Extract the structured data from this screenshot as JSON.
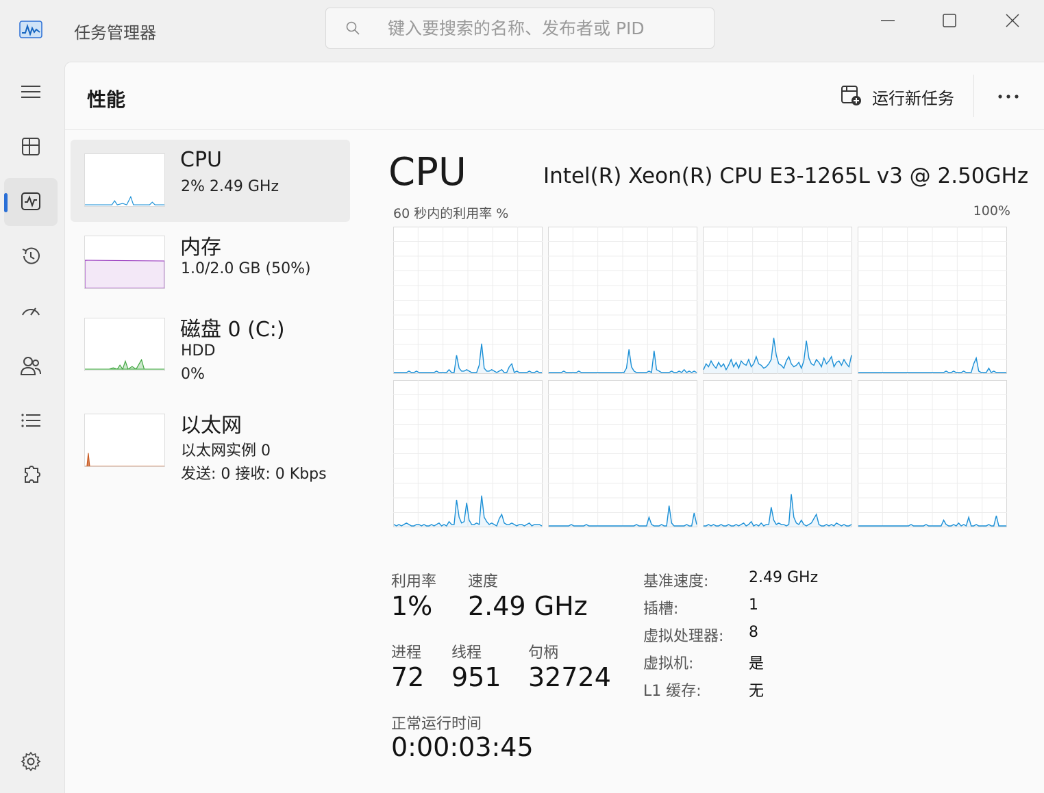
{
  "window": {
    "title": "任务管理器",
    "search_placeholder": "键入要搜索的名称、发布者或 PID"
  },
  "nav": {
    "items": [
      {
        "name": "menu"
      },
      {
        "name": "processes"
      },
      {
        "name": "performance",
        "active": true
      },
      {
        "name": "app-history"
      },
      {
        "name": "startup-apps"
      },
      {
        "name": "users"
      },
      {
        "name": "details"
      },
      {
        "name": "services"
      },
      {
        "name": "settings"
      }
    ]
  },
  "header": {
    "title": "性能",
    "run_new_task": "运行新任务"
  },
  "resources": [
    {
      "title": "CPU",
      "sub1": "2%  2.49 GHz",
      "sub2": "",
      "sub3": "",
      "selected": true,
      "color": "#1a8fd6"
    },
    {
      "title": "内存",
      "sub1": "1.0/2.0 GB (50%)",
      "sub2": "",
      "sub3": "",
      "color": "#9b3fc0"
    },
    {
      "title": "磁盘 0 (C:)",
      "sub1": "HDD",
      "sub2": "0%",
      "sub3": "",
      "color": "#3fa63f"
    },
    {
      "title": "以太网",
      "sub1": "以太网实例 0",
      "sub2": "发送: 0  接收: 0 Kbps",
      "sub3": "",
      "color": "#c8581e"
    }
  ],
  "cpu": {
    "title": "CPU",
    "model": "Intel(R) Xeon(R) CPU E3-1265L v3 @ 2.50GHz",
    "graph_label": "60 秒内的利用率 %",
    "graph_max": "100%",
    "line_color": "#1a8fd6",
    "core_series": [
      [
        0,
        0,
        0,
        0,
        0,
        0,
        1,
        0,
        0,
        1,
        0,
        0,
        0,
        0,
        0,
        0,
        0,
        1,
        0,
        0,
        0,
        0,
        2,
        0,
        0,
        12,
        3,
        1,
        1,
        2,
        1,
        0,
        0,
        0,
        5,
        20,
        3,
        1,
        1,
        2,
        1,
        0,
        1,
        2,
        0,
        0,
        4,
        6,
        0,
        1,
        0,
        0,
        0,
        0,
        1,
        0,
        0,
        1,
        0,
        0
      ],
      [
        0,
        0,
        0,
        0,
        0,
        0,
        1,
        0,
        0,
        0,
        0,
        0,
        1,
        0,
        0,
        0,
        0,
        0,
        0,
        0,
        0,
        0,
        0,
        0,
        0,
        0,
        0,
        0,
        0,
        0,
        0,
        3,
        16,
        4,
        1,
        0,
        0,
        0,
        0,
        0,
        1,
        0,
        15,
        2,
        1,
        0,
        0,
        0,
        0,
        1,
        0,
        0,
        1,
        0,
        2,
        0,
        1,
        0,
        1,
        0
      ],
      [
        2,
        6,
        4,
        8,
        5,
        3,
        7,
        4,
        6,
        2,
        5,
        9,
        4,
        7,
        3,
        8,
        6,
        5,
        9,
        4,
        6,
        11,
        6,
        5,
        3,
        4,
        6,
        9,
        24,
        12,
        6,
        5,
        3,
        8,
        11,
        6,
        4,
        5,
        7,
        3,
        8,
        22,
        10,
        6,
        5,
        9,
        7,
        4,
        10,
        6,
        8,
        11,
        4,
        7,
        8,
        5,
        9,
        6,
        4,
        12
      ],
      [
        0,
        0,
        0,
        0,
        0,
        0,
        0,
        0,
        0,
        0,
        0,
        0,
        0,
        0,
        0,
        0,
        0,
        0,
        0,
        0,
        0,
        0,
        0,
        0,
        0,
        0,
        0,
        0,
        0,
        0,
        0,
        0,
        0,
        0,
        0,
        1,
        0,
        0,
        1,
        0,
        0,
        0,
        1,
        0,
        0,
        0,
        6,
        10,
        1,
        0,
        0,
        0,
        3,
        0,
        1,
        0,
        0,
        0,
        0,
        0
      ],
      [
        1,
        0,
        1,
        0,
        1,
        2,
        1,
        0,
        0,
        1,
        1,
        0,
        1,
        0,
        0,
        1,
        0,
        1,
        2,
        0,
        1,
        0,
        3,
        1,
        1,
        18,
        6,
        2,
        3,
        16,
        4,
        1,
        1,
        2,
        1,
        21,
        6,
        3,
        1,
        2,
        1,
        0,
        5,
        8,
        2,
        1,
        1,
        2,
        1,
        0,
        1,
        1,
        0,
        1,
        2,
        0,
        1,
        1,
        1,
        0
      ],
      [
        0,
        0,
        0,
        0,
        0,
        0,
        0,
        0,
        0,
        1,
        0,
        0,
        0,
        0,
        0,
        1,
        0,
        0,
        0,
        0,
        0,
        0,
        0,
        0,
        0,
        0,
        0,
        0,
        0,
        0,
        0,
        0,
        0,
        0,
        0,
        1,
        0,
        0,
        0,
        0,
        6,
        1,
        0,
        0,
        0,
        1,
        0,
        0,
        14,
        2,
        0,
        0,
        0,
        0,
        0,
        1,
        0,
        0,
        9,
        1
      ],
      [
        0,
        0,
        1,
        0,
        1,
        0,
        0,
        1,
        0,
        0,
        1,
        0,
        0,
        1,
        0,
        1,
        2,
        0,
        1,
        3,
        0,
        1,
        0,
        2,
        0,
        1,
        1,
        13,
        4,
        1,
        2,
        1,
        1,
        0,
        1,
        22,
        6,
        2,
        1,
        4,
        1,
        0,
        1,
        2,
        5,
        8,
        1,
        0,
        0,
        1,
        0,
        1,
        0,
        2,
        1,
        0,
        1,
        0,
        0,
        1
      ],
      [
        0,
        0,
        0,
        0,
        0,
        0,
        0,
        0,
        0,
        0,
        0,
        0,
        0,
        0,
        0,
        0,
        0,
        0,
        0,
        0,
        0,
        1,
        0,
        0,
        0,
        0,
        0,
        1,
        0,
        0,
        0,
        0,
        0,
        0,
        4,
        1,
        0,
        0,
        1,
        0,
        2,
        0,
        1,
        0,
        6,
        0,
        0,
        1,
        0,
        0,
        0,
        0,
        1,
        0,
        0,
        7,
        0,
        0,
        0,
        0
      ]
    ]
  },
  "stats": {
    "utilization_label": "利用率",
    "utilization_value": "1%",
    "speed_label": "速度",
    "speed_value": "2.49 GHz",
    "processes_label": "进程",
    "processes_value": "72",
    "threads_label": "线程",
    "threads_value": "951",
    "handles_label": "句柄",
    "handles_value": "32724",
    "uptime_label": "正常运行时间",
    "uptime_value": "0:00:03:45",
    "details": [
      {
        "key": "基准速度:",
        "value": "2.49 GHz"
      },
      {
        "key": "插槽:",
        "value": "1"
      },
      {
        "key": "虚拟处理器:",
        "value": "8"
      },
      {
        "key": "虚拟机:",
        "value": "是"
      },
      {
        "key": "L1 缓存:",
        "value": "无"
      }
    ]
  }
}
